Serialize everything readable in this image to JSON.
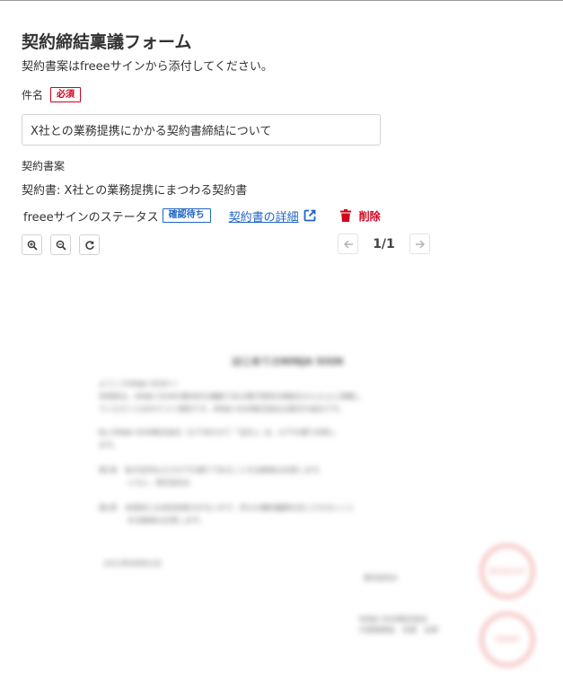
{
  "form": {
    "title": "契約締結稟議フォーム",
    "subtitle": "契約書案はfreeeサインから添付してください。"
  },
  "subject_field": {
    "label": "件名",
    "required_badge": "必須",
    "value": "X社との業務提携にかかる契約書締結について"
  },
  "contract_draft": {
    "label": "契約書案",
    "contract_line": "契約書: X社との業務提携にまつわる契約書",
    "status_label": "freeeサインのステータス",
    "status_badge": "確認待ち",
    "detail_link": "契約書の詳細",
    "delete_label": "削除"
  },
  "viewer": {
    "page_indicator": "1/1",
    "icons": [
      "zoom-in-icon",
      "zoom-out-icon",
      "refresh-icon",
      "arrow-left-icon",
      "arrow-right-icon"
    ]
  },
  "document_preview": {
    "title": "はじめてのNINJA SIGN",
    "lines": [
      "ようこそNINJA SIGNへ！",
      "本契約は、NINJA SIGNの基本的な機能である電子契約の締結をかんたんに体験し",
      "ていただくためのテスト契約です。NINJA SIGN株式会社は架空の会社です。",
      "私とNINJA SIGN株式会社（以下あわせて「当方」）は、以下の通り合意し",
      "ます。",
      "第1条　私の住所および以下の通りであることを当事者は合意します。",
      "　　　　ともに、株式会社A",
      "第2条　本契約には法的拘束力がないので、何らの権利義務を生じさせないこと",
      "　　　　を当事者は合意します。",
      "2021年08月01日",
      "株式会社A",
      "NINJA SIGN株式会社",
      "代表取締役　忍者　太郎"
    ],
    "stamps": [
      "株式会社A印",
      "代表者印"
    ]
  },
  "colors": {
    "link": "#1f64c4",
    "danger": "#d0021b",
    "stamp": "#f0a0a0"
  }
}
